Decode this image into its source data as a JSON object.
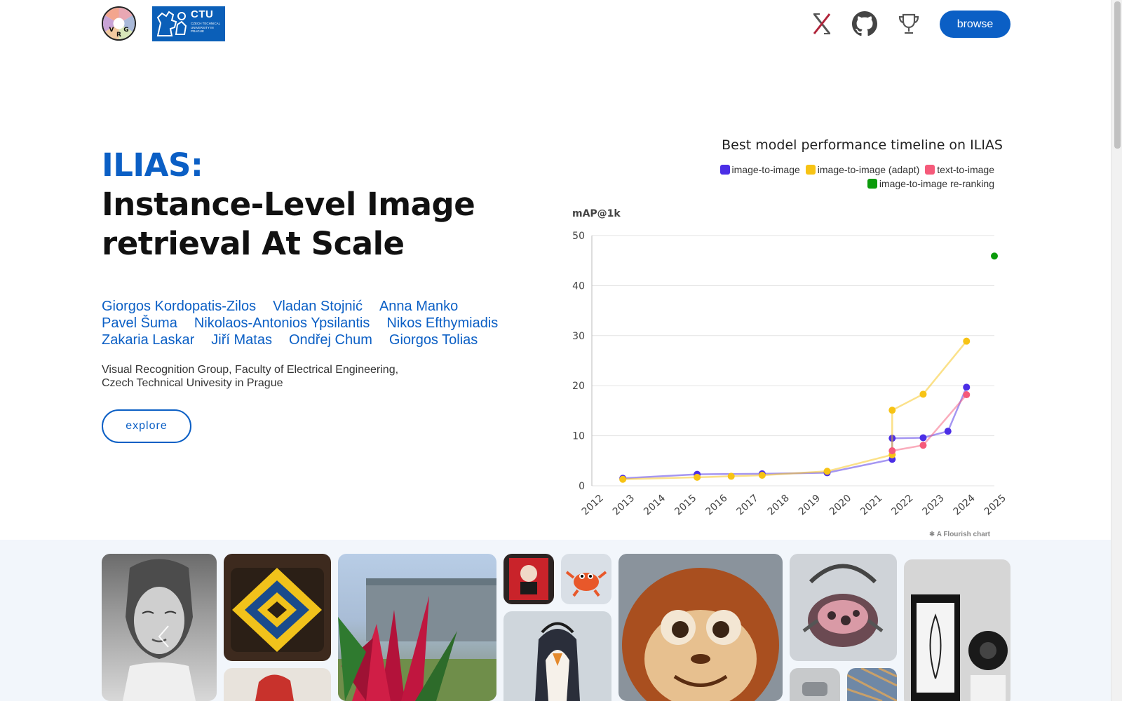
{
  "header": {
    "vrg_logo_letters": [
      "V",
      "R",
      "G"
    ],
    "ctu_logo_text": "CTU",
    "ctu_logo_subtitle": "CZECH TECHNICAL UNIVERSITY IN PRAGUE",
    "icons": [
      "x-logo-icon",
      "github-icon",
      "trophy-icon"
    ],
    "browse_label": "browse"
  },
  "hero": {
    "title": "ILIAS:",
    "subtitle": "Instance-Level Image retrieval At Scale",
    "authors": [
      [
        "Giorgos Kordopatis-Zilos",
        "Vladan Stojnić",
        "Anna Manko"
      ],
      [
        "Pavel Šuma",
        "Nikolaos-Antonios Ypsilantis",
        "Nikos Efthymiadis"
      ],
      [
        "Zakaria Laskar",
        "Jiří Matas",
        "Ondřej Chum",
        "Giorgos Tolias"
      ]
    ],
    "affiliation_line1": "Visual Recognition Group, Faculty of Electrical Engineering,",
    "affiliation_line2": "Czech Technical Univesity in Prague",
    "explore_label": "explore"
  },
  "chart_data": {
    "type": "line",
    "title": "Best model performance timeline on ILIAS",
    "ylabel": "mAP@1k",
    "xlabel": "",
    "ylim": [
      0,
      50
    ],
    "yticks": [
      0,
      10,
      20,
      30,
      40,
      50
    ],
    "xlim": [
      2012,
      2025
    ],
    "xticks": [
      "2012",
      "2013",
      "2014",
      "2015",
      "2016",
      "2017",
      "2018",
      "2019",
      "2020",
      "2021",
      "2022",
      "2023",
      "2024",
      "2025"
    ],
    "grid": true,
    "legend_position": "top-right",
    "series": [
      {
        "name": "image-to-image",
        "color": "#4b2ee6",
        "x": [
          2013.0,
          2015.4,
          2017.5,
          2019.6,
          2021.7,
          2021.7,
          2022.7,
          2023.5,
          2024.1
        ],
        "y": [
          1.5,
          2.3,
          2.4,
          2.6,
          5.3,
          9.5,
          9.6,
          10.9,
          19.7
        ]
      },
      {
        "name": "image-to-image (adapt)",
        "color": "#f7c314",
        "x": [
          2013.0,
          2015.4,
          2016.5,
          2017.5,
          2019.6,
          2021.7,
          2021.7,
          2022.7,
          2024.1
        ],
        "y": [
          1.3,
          1.7,
          1.9,
          2.1,
          2.9,
          6.2,
          15.1,
          18.3,
          28.9
        ]
      },
      {
        "name": "text-to-image",
        "color": "#f55a7a",
        "x": [
          2021.7,
          2022.7,
          2024.1
        ],
        "y": [
          7.0,
          8.1,
          18.2
        ]
      },
      {
        "name": "image-to-image re-ranking",
        "color": "#0b9b0b",
        "x": [
          2025.0
        ],
        "y": [
          45.9
        ]
      }
    ]
  },
  "flourish_credit": "A Flourish chart",
  "gallery": {
    "prev_icon": "chevron-left-icon"
  }
}
